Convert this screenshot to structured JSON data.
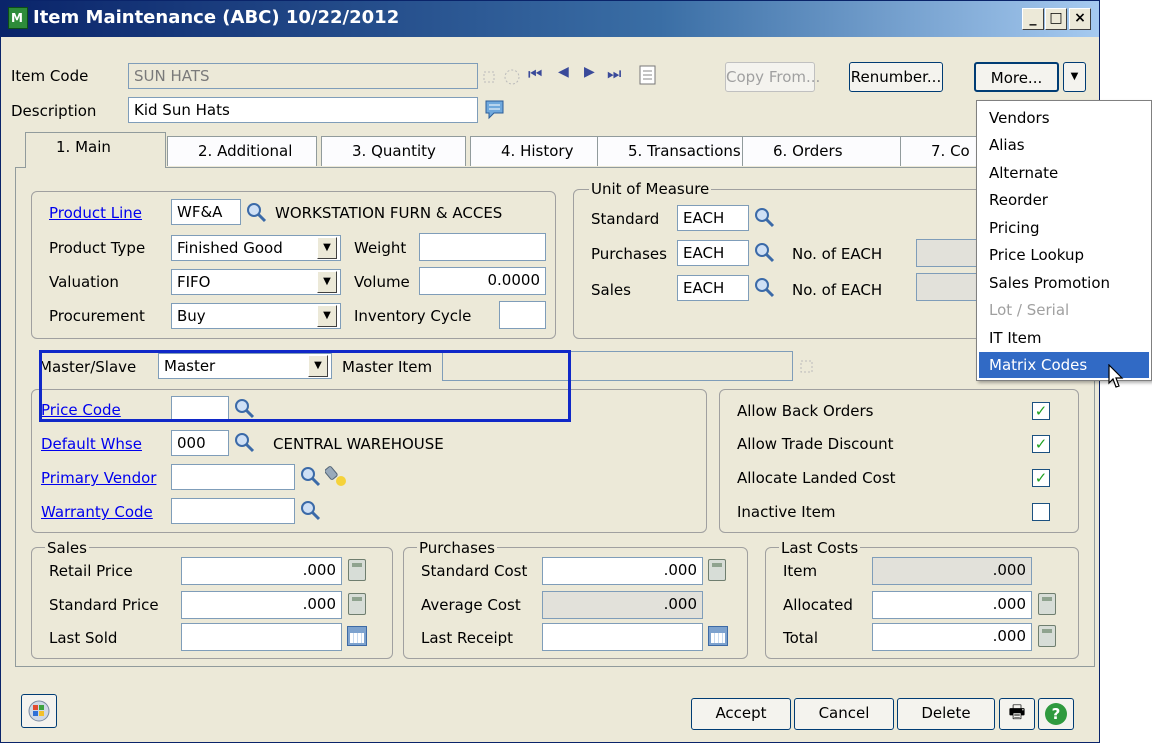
{
  "window": {
    "title": "Item Maintenance (ABC) 10/22/2012",
    "min_glyph": "_",
    "max_glyph": "□",
    "close_glyph": "×",
    "app_icon_text": "M"
  },
  "header": {
    "item_code_label": "Item Code",
    "item_code_value": "SUN HATS",
    "description_label": "Description",
    "description_value": "Kid Sun Hats",
    "copy_from_label": "Copy From...",
    "renumber_label": "Renumber...",
    "more_label": "More...",
    "nav_first": "⏮",
    "nav_prev": "◀",
    "nav_next": "▶",
    "nav_last": "⏭"
  },
  "tabs": [
    {
      "label": "1. Main",
      "active": true
    },
    {
      "label": "2. Additional"
    },
    {
      "label": "3. Quantity"
    },
    {
      "label": "4. History"
    },
    {
      "label": "5. Transactions"
    },
    {
      "label": "6. Orders"
    },
    {
      "label": "7. Co"
    }
  ],
  "main": {
    "product_line_label": "Product Line",
    "product_line_value": "WF&A",
    "product_line_desc": "WORKSTATION FURN & ACCES",
    "product_type_label": "Product Type",
    "product_type_value": "Finished Good",
    "valuation_label": "Valuation",
    "valuation_value": "FIFO",
    "procurement_label": "Procurement",
    "procurement_value": "Buy",
    "weight_label": "Weight",
    "weight_value": "",
    "volume_label": "Volume",
    "volume_value": "0.0000",
    "inventory_cycle_label": "Inventory Cycle",
    "inventory_cycle_value": ""
  },
  "uom": {
    "title": "Unit of Measure",
    "standard_label": "Standard",
    "standard_value": "EACH",
    "purchases_label": "Purchases",
    "purchases_value": "EACH",
    "purchases_no_label": "No. of EACH",
    "sales_label": "Sales",
    "sales_value": "EACH",
    "sales_no_label": "No. of EACH"
  },
  "master": {
    "master_slave_label": "Master/Slave",
    "master_slave_value": "Master",
    "master_item_label": "Master Item",
    "master_item_value": ""
  },
  "codes": {
    "price_code_label": "Price Code",
    "price_code_value": "",
    "default_whse_label": "Default Whse",
    "default_whse_value": "000",
    "default_whse_desc": "CENTRAL WAREHOUSE",
    "primary_vendor_label": "Primary Vendor",
    "primary_vendor_value": "",
    "warranty_code_label": "Warranty Code",
    "warranty_code_value": ""
  },
  "options": {
    "allow_back_orders_label": "Allow Back Orders",
    "allow_back_orders": true,
    "allow_trade_discount_label": "Allow Trade Discount",
    "allow_trade_discount": true,
    "allocate_landed_cost_label": "Allocate Landed Cost",
    "allocate_landed_cost": true,
    "inactive_item_label": "Inactive Item",
    "inactive_item": false,
    "check_glyph": "✓"
  },
  "sales": {
    "title": "Sales",
    "retail_price_label": "Retail Price",
    "retail_price_value": ".000",
    "standard_price_label": "Standard Price",
    "standard_price_value": ".000",
    "last_sold_label": "Last Sold",
    "last_sold_value": ""
  },
  "purchases": {
    "title": "Purchases",
    "standard_cost_label": "Standard Cost",
    "standard_cost_value": ".000",
    "average_cost_label": "Average Cost",
    "average_cost_value": ".000",
    "last_receipt_label": "Last Receipt",
    "last_receipt_value": ""
  },
  "last_costs": {
    "title": "Last Costs",
    "item_label": "Item",
    "item_value": ".000",
    "allocated_label": "Allocated",
    "allocated_value": ".000",
    "total_label": "Total",
    "total_value": ".000"
  },
  "footer": {
    "accept_label": "Accept",
    "cancel_label": "Cancel",
    "delete_label": "Delete",
    "print_glyph": "🖶",
    "help_glyph": "?"
  },
  "more_menu": {
    "items": [
      {
        "label": "Vendors"
      },
      {
        "label": "Alias"
      },
      {
        "label": "Alternate"
      },
      {
        "label": "Reorder"
      },
      {
        "label": "Pricing"
      },
      {
        "label": "Price Lookup"
      },
      {
        "label": "Sales Promotion"
      },
      {
        "label": "Lot / Serial",
        "disabled": true
      },
      {
        "label": "IT Item"
      },
      {
        "label": "Matrix Codes",
        "highlighted": true
      }
    ]
  },
  "colors": {
    "title_bar": "#0a246a",
    "window_bg": "#ece9d8",
    "highlight_box": "#1028c8",
    "menu_highlight": "#316ac5",
    "link": "#0000ee"
  }
}
